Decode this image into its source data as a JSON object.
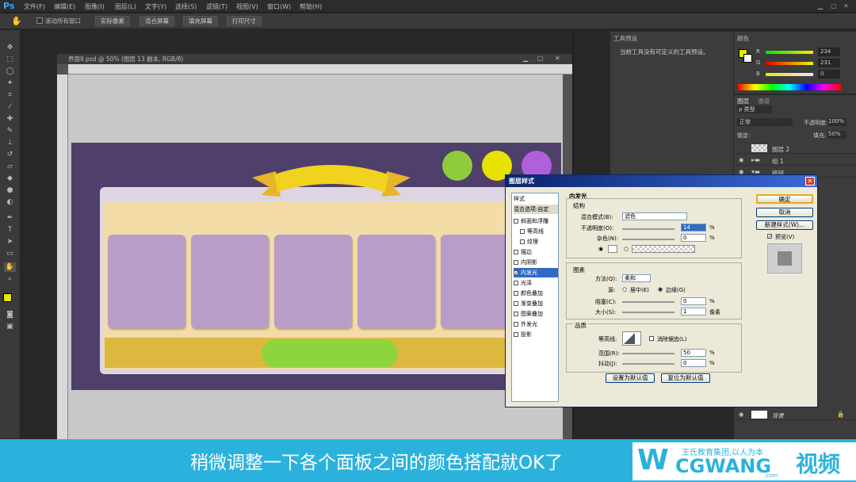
{
  "app": {
    "logo": "Ps"
  },
  "menu": [
    "文件(F)",
    "编辑(E)",
    "图像(I)",
    "图层(L)",
    "文字(Y)",
    "选择(S)",
    "滤镜(T)",
    "视图(V)",
    "窗口(W)",
    "帮助(H)"
  ],
  "options_bar": {
    "checkbox_label": "滚动所有窗口",
    "buttons": [
      "实际像素",
      "适合屏幕",
      "填充屏幕",
      "打印尺寸"
    ]
  },
  "document": {
    "title": "界面9.psd @ 50% (图层 13 副本, RGB/8)"
  },
  "tool_preset_panel": {
    "title": "工具预设",
    "message": "当前工具没有可定义的工具预设。"
  },
  "color_panel": {
    "title": "颜色",
    "channels": [
      {
        "label": "R",
        "value": "234"
      },
      {
        "label": "G",
        "value": "231"
      },
      {
        "label": "B",
        "value": "0"
      }
    ],
    "fg_color": "#eae700"
  },
  "layers_panel": {
    "tabs": [
      "图层",
      "通道"
    ],
    "filter_label": "ρ 类型",
    "blend_mode": "正常",
    "opacity_label": "不透明度:",
    "opacity_value": "100%",
    "lock_label": "锁定:",
    "fill_label": "填充:",
    "fill_value": "50%",
    "layers": [
      "图层 2",
      "组 1",
      "按钮"
    ],
    "background_layer": "背景"
  },
  "dialog": {
    "title": "图层样式",
    "style_list_title": "样式",
    "blend_options": "混合选项:自定",
    "styles": [
      {
        "label": "斜面和浮雕",
        "checked": false
      },
      {
        "label": "等高线",
        "checked": false
      },
      {
        "label": "纹理",
        "checked": false
      },
      {
        "label": "描边",
        "checked": false
      },
      {
        "label": "内阴影",
        "checked": false
      },
      {
        "label": "内发光",
        "checked": true
      },
      {
        "label": "光泽",
        "checked": false
      },
      {
        "label": "颜色叠加",
        "checked": false
      },
      {
        "label": "渐变叠加",
        "checked": false
      },
      {
        "label": "图案叠加",
        "checked": false
      },
      {
        "label": "外发光",
        "checked": false
      },
      {
        "label": "投影",
        "checked": false
      }
    ],
    "section_title": "内发光",
    "structure": {
      "title": "结构",
      "blend_mode_label": "混合模式(B):",
      "blend_mode_value": "滤色",
      "opacity_label": "不透明度(O):",
      "opacity_value": "14",
      "noise_label": "杂色(N):",
      "noise_value": "0",
      "percent": "%"
    },
    "elements": {
      "title": "图素",
      "method_label": "方法(Q):",
      "method_value": "柔和",
      "source_label": "源:",
      "center_label": "居中(E)",
      "edge_label": "边缘(G)",
      "choke_label": "阻塞(C):",
      "choke_value": "0",
      "size_label": "大小(S):",
      "size_value": "1",
      "px_unit": "像素"
    },
    "quality": {
      "title": "品质",
      "contour_label": "等高线:",
      "anti_alias_label": "消除锯齿(L)",
      "range_label": "范围(R):",
      "range_value": "50",
      "jitter_label": "抖动(J):",
      "jitter_value": "0"
    },
    "buttons": {
      "ok": "确定",
      "cancel": "取消",
      "new_style": "新建样式(W)...",
      "preview": "预览(V)",
      "make_default": "设置为默认值",
      "reset_default": "复位为默认值"
    }
  },
  "subtitle": "稍微调整一下各个面板之间的颜色搭配就OK了",
  "brand": {
    "top": "王氏教育集团,以人为本",
    "main": "CGWANG",
    "suffix": "视频",
    "domain": ".com"
  }
}
